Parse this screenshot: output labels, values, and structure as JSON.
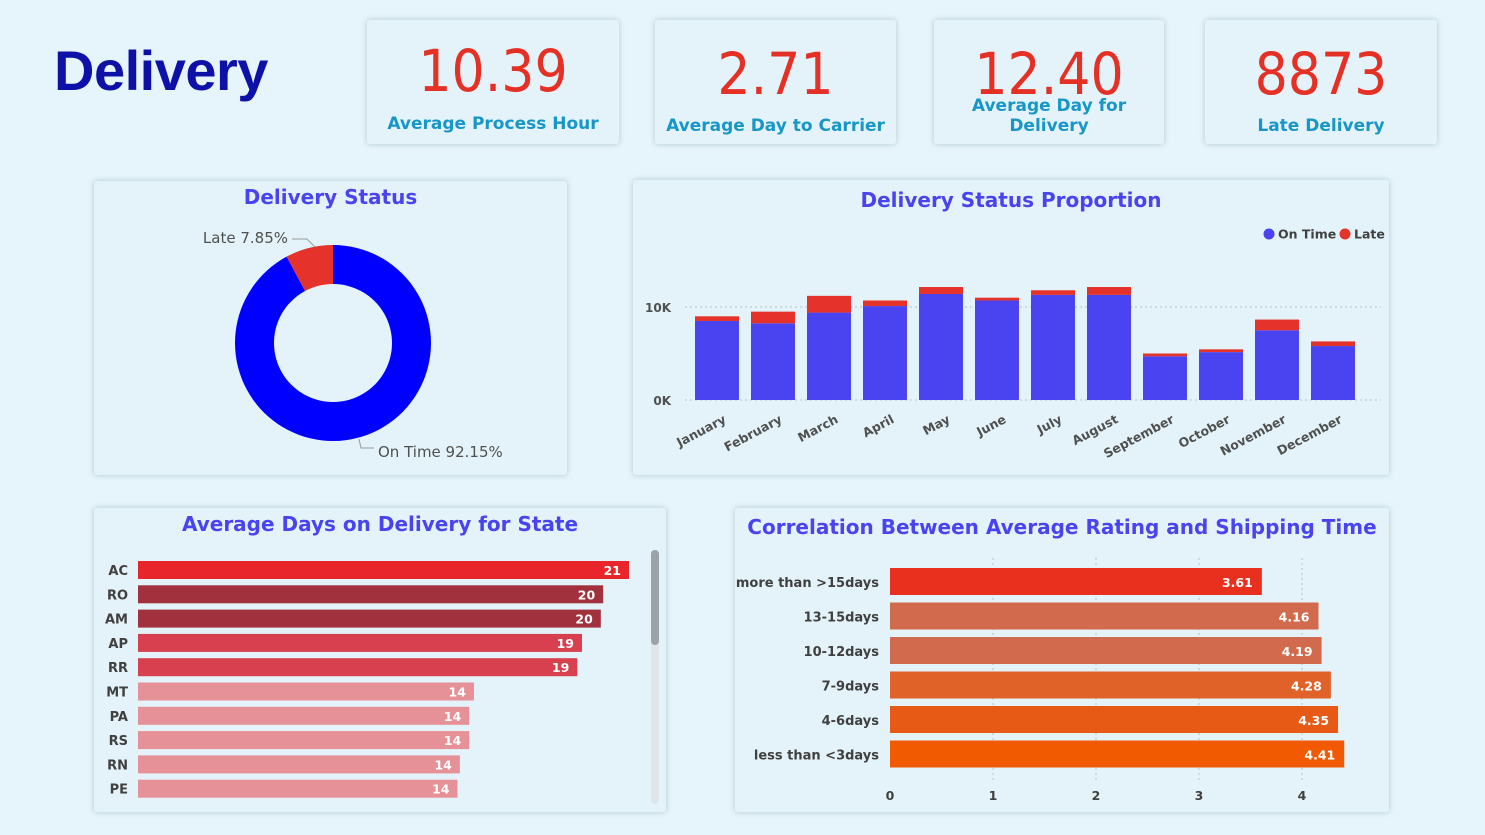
{
  "page": {
    "title": "Delivery"
  },
  "kpis": [
    {
      "value": "10.39",
      "label": "Average Process Hour"
    },
    {
      "value": "2.71",
      "label": "Average Day to Carrier"
    },
    {
      "value": "12.40",
      "label": "Average Day for Delivery"
    },
    {
      "value": "8873",
      "label": "Late Delivery"
    }
  ],
  "colors": {
    "accent_red": "#e53025",
    "blue": "#0000ff",
    "series_blue": "#4a43f0",
    "title_blue": "#0d11a8",
    "kpi_label": "#1896c8"
  },
  "chart_data": [
    {
      "type": "pie",
      "title": "Delivery Status",
      "labels": [
        "On Time",
        "Late"
      ],
      "values": [
        92.15,
        7.85
      ],
      "data_labels": [
        "On Time 92.15%",
        "Late 7.85%"
      ],
      "colors": [
        "#0000ff",
        "#e5322a"
      ]
    },
    {
      "type": "bar",
      "stacked": true,
      "title": "Delivery Status Proportion",
      "categories": [
        "January",
        "February",
        "March",
        "April",
        "May",
        "June",
        "July",
        "August",
        "September",
        "October",
        "November",
        "December"
      ],
      "series": [
        {
          "name": "On Time",
          "color": "#4a43f0",
          "values": [
            8500,
            8250,
            9400,
            10100,
            11400,
            10700,
            11300,
            11300,
            4700,
            5150,
            7500,
            5800
          ]
        },
        {
          "name": "Late",
          "color": "#e5322a",
          "values": [
            500,
            1250,
            1800,
            600,
            750,
            300,
            500,
            850,
            300,
            300,
            1150,
            500
          ]
        }
      ],
      "yticks": [
        {
          "value": 0,
          "label": "0K"
        },
        {
          "value": 10000,
          "label": "10K"
        }
      ],
      "ylim": [
        0,
        13000
      ],
      "legend": "top-right",
      "grid": true
    },
    {
      "type": "bar",
      "orientation": "horizontal",
      "title": "Average Days on Delivery for State",
      "categories": [
        "AC",
        "RO",
        "AM",
        "AP",
        "RR",
        "MT",
        "PA",
        "RS",
        "RN",
        "PE"
      ],
      "values": [
        21,
        20,
        20,
        19,
        19,
        14,
        14,
        14,
        14,
        14
      ],
      "bar_lengths": [
        20.9,
        19.8,
        19.7,
        18.9,
        18.7,
        14.3,
        14.1,
        14.1,
        13.7,
        13.6
      ],
      "colors": [
        "#e8252b",
        "#a1313c",
        "#a1313c",
        "#d8404f",
        "#d8404f",
        "#e69097",
        "#e69097",
        "#e69097",
        "#e69097",
        "#e69097"
      ],
      "xlim": [
        0,
        21.5
      ]
    },
    {
      "type": "bar",
      "orientation": "horizontal",
      "title": "Correlation Between Average Rating and Shipping Time",
      "categories": [
        "more than >15days",
        "13-15days",
        "10-12days",
        "7-9days",
        "4-6days",
        "less than <3days"
      ],
      "values": [
        3.61,
        4.16,
        4.19,
        4.28,
        4.35,
        4.41
      ],
      "colors": [
        "#e9301e",
        "#d26a4e",
        "#d26a4e",
        "#e06228",
        "#e65a16",
        "#f25a02"
      ],
      "xticks": [
        0,
        1,
        2,
        3,
        4
      ],
      "xlim": [
        0,
        4.5
      ],
      "grid": true
    }
  ]
}
